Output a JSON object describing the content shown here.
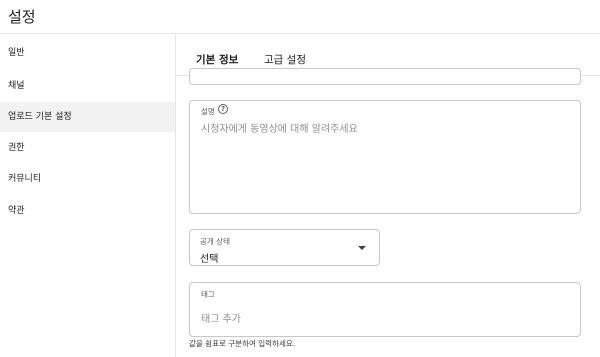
{
  "header": {
    "title": "설정"
  },
  "sidebar": {
    "items": [
      {
        "label": "일반"
      },
      {
        "label": "채널"
      },
      {
        "label": "업로드 기본 설정"
      },
      {
        "label": "권한"
      },
      {
        "label": "커뮤니티"
      },
      {
        "label": "약관"
      }
    ]
  },
  "tabs": [
    {
      "label": "기본 정보"
    },
    {
      "label": "고급 설정"
    }
  ],
  "description": {
    "label": "설명",
    "help_icon": "?",
    "placeholder": "시청자에게 동영상에 대해 알려주세요"
  },
  "visibility": {
    "label": "공개 상태",
    "value": "선택"
  },
  "tags": {
    "label": "태그",
    "placeholder": "태그 추가",
    "hint": "값을 쉼표로 구분하여 입력하세요."
  },
  "colors": {
    "accent": "#1a73e8",
    "border": "#c8c8c8",
    "active_bg": "#f2f2f2"
  }
}
